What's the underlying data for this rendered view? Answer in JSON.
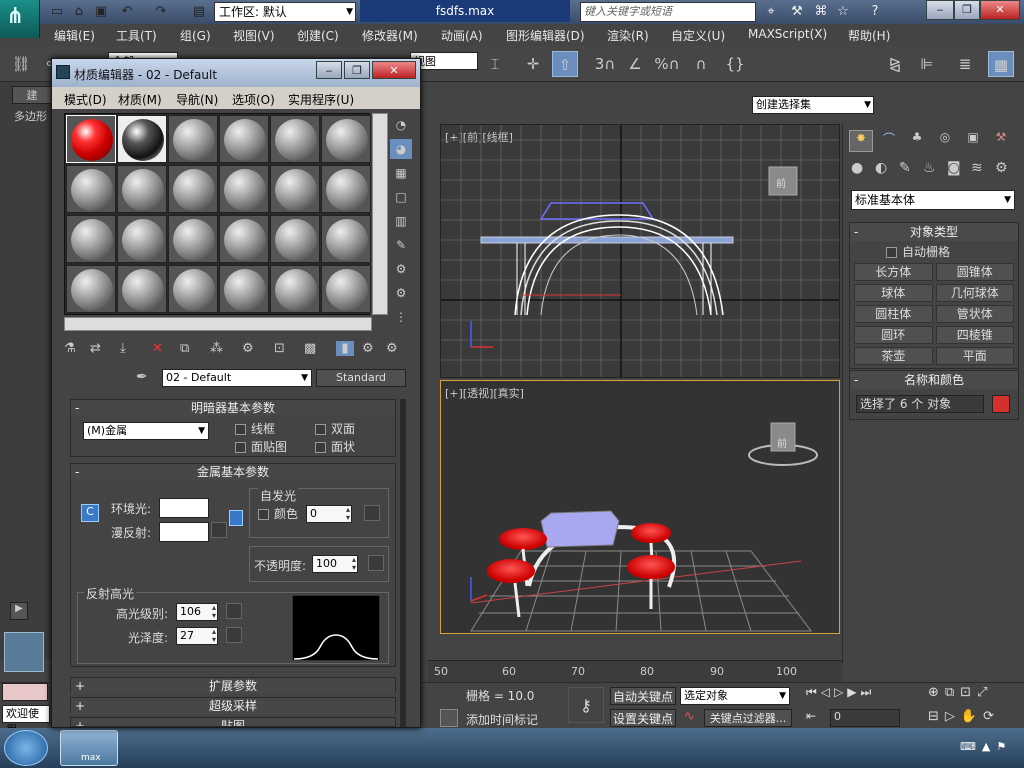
{
  "app": {
    "logo": "max",
    "workspace_label": "工作区: 默认",
    "file_title": "fsdfs.max",
    "search_placeholder": "键入关键字或短语"
  },
  "menu": [
    "编辑(E)",
    "工具(T)",
    "组(G)",
    "视图(V)",
    "创建(C)",
    "修改器(M)",
    "动画(A)",
    "图形编辑器(D)",
    "渲染(R)",
    "自定义(U)",
    "MAXScript(X)",
    "帮助(H)"
  ],
  "toolbar": {
    "filter": "全部",
    "view_ref": "视图",
    "snap_3": "3",
    "snap_pct": "%",
    "selection_set_placeholder": "创建选择集"
  },
  "left_strip": {
    "tab1": "建",
    "tab2": "多边形"
  },
  "viewports": {
    "top": {
      "label": "[+][前][线框]",
      "viewcube_label": "前"
    },
    "persp": {
      "label": "[+][透视][真实]",
      "viewcube_label": "前"
    }
  },
  "command_panel": {
    "category": "标准基本体",
    "object_type_title": "对象类型",
    "autogrid": "自动栅格",
    "buttons": [
      "长方体",
      "圆锥体",
      "球体",
      "几何球体",
      "圆柱体",
      "管状体",
      "圆环",
      "四棱锥",
      "茶壶",
      "平面"
    ],
    "name_color_title": "名称和颜色",
    "name_value": "选择了 6 个 对象",
    "object_color": "#d43030"
  },
  "timeline": {
    "ticks": [
      "50",
      "60",
      "70",
      "80",
      "90",
      "100"
    ]
  },
  "status": {
    "welcome": "欢迎使用",
    "grid": "栅格 = 10.0",
    "add_time_tag": "添加时间标记",
    "auto_key": "自动关键点",
    "set_key": "设置关键点",
    "key_mode": "选定对象",
    "key_filters": "关键点过滤器...",
    "frame": "0"
  },
  "taskbar": {
    "app_label": "max"
  },
  "material_editor": {
    "title": "材质编辑器 - 02 - Default",
    "menu": [
      "模式(D)",
      "材质(M)",
      "导航(N)",
      "选项(O)",
      "实用程序(U)"
    ],
    "material_name": "02 - Default",
    "material_type": "Standard",
    "shader_title": "明暗器基本参数",
    "shader": "(M)金属",
    "wire": "线框",
    "two_sided": "双面",
    "face_map": "面贴图",
    "faceted": "面状",
    "metal_title": "金属基本参数",
    "ambient_label": "环境光:",
    "diffuse_label": "漫反射:",
    "c_btn": "C",
    "self_illum_title": "自发光",
    "color_label": "颜色",
    "self_illum_value": "0",
    "opacity_label": "不透明度:",
    "opacity_value": "100",
    "specular_title": "反射高光",
    "spec_level_label": "高光级别:",
    "spec_level_value": "106",
    "gloss_label": "光泽度:",
    "gloss_value": "27",
    "rollups": [
      "扩展参数",
      "超级采样",
      "贴图"
    ]
  }
}
